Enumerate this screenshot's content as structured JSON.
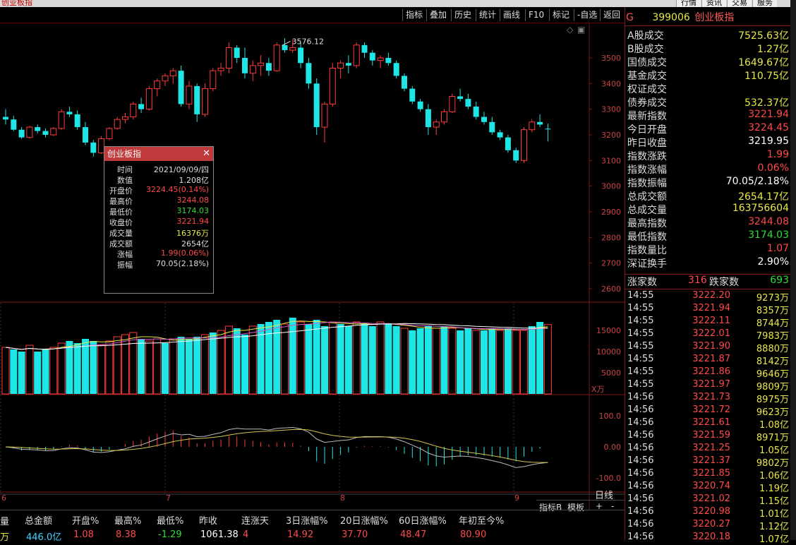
{
  "window": {
    "title": "创业板指",
    "buttons": [
      "行情",
      "资讯",
      "交易",
      "服务"
    ]
  },
  "toolbar": {
    "items": [
      "指标",
      "叠加",
      "历史",
      "统计",
      "画线",
      "F10",
      "标记",
      "-自选",
      "返回"
    ]
  },
  "symbol": {
    "code": "399006",
    "name": "创业板指",
    "prefix": "G"
  },
  "quotes": [
    {
      "label": "A股成交",
      "value": "7525.63亿",
      "color": "#e8e84a"
    },
    {
      "label": "B股成交",
      "value": "1.27亿",
      "color": "#e8e84a"
    },
    {
      "label": "国债成交",
      "value": "1649.67亿",
      "color": "#e8e84a"
    },
    {
      "label": "基金成交",
      "value": "110.75亿",
      "color": "#e8e84a"
    },
    {
      "label": "权证成交",
      "value": "",
      "color": "#e8e84a"
    },
    {
      "label": "债券成交",
      "value": "532.37亿",
      "color": "#e8e84a"
    },
    {
      "label": "最新指数",
      "value": "3221.94",
      "color": "#ff4a4a"
    },
    {
      "label": "今日开盘",
      "value": "3224.45",
      "color": "#ff4a4a"
    },
    {
      "label": "昨日收盘",
      "value": "3219.95",
      "color": "#ffffff"
    },
    {
      "label": "指数涨跌",
      "value": "1.99",
      "color": "#ff4a4a"
    },
    {
      "label": "指数涨幅",
      "value": "0.06%",
      "color": "#ff4a4a"
    },
    {
      "label": "指数振幅",
      "value": "70.05/2.18%",
      "color": "#ffffff"
    },
    {
      "label": "总成交额",
      "value": "2654.17亿",
      "color": "#e8e84a"
    },
    {
      "label": "总成交量",
      "value": "163756604",
      "color": "#e8e84a"
    },
    {
      "label": "最高指数",
      "value": "3244.08",
      "color": "#ff4a4a"
    },
    {
      "label": "最低指数",
      "value": "3174.03",
      "color": "#33dd33"
    },
    {
      "label": "指数量比",
      "value": "1.07",
      "color": "#ff4a4a"
    },
    {
      "label": "深证换手",
      "value": "2.90%",
      "color": "#ffffff"
    }
  ],
  "breadth": {
    "up_label": "涨家数",
    "up": "316",
    "down_label": "跌家数",
    "down": "693"
  },
  "ticks": [
    {
      "t": "14:55",
      "p": "3222.20",
      "q": "9273万"
    },
    {
      "t": "14:55",
      "p": "3221.94",
      "q": "8357万"
    },
    {
      "t": "14:55",
      "p": "3222.11",
      "q": "8744万"
    },
    {
      "t": "14:55",
      "p": "3222.01",
      "q": "7983万"
    },
    {
      "t": "14:55",
      "p": "3221.90",
      "q": "8880万"
    },
    {
      "t": "14:55",
      "p": "3221.87",
      "q": "8142万"
    },
    {
      "t": "14:55",
      "p": "3221.86",
      "q": "9646万"
    },
    {
      "t": "14:55",
      "p": "3221.97",
      "q": "9809万"
    },
    {
      "t": "14:56",
      "p": "3221.73",
      "q": "8975万"
    },
    {
      "t": "14:56",
      "p": "3221.72",
      "q": "9623万"
    },
    {
      "t": "14:56",
      "p": "3221.61",
      "q": "1.08亿"
    },
    {
      "t": "14:56",
      "p": "3221.59",
      "q": "8971万"
    },
    {
      "t": "14:56",
      "p": "3221.25",
      "q": "1.05亿"
    },
    {
      "t": "14:56",
      "p": "3221.37",
      "q": "9802万"
    },
    {
      "t": "14:56",
      "p": "3221.85",
      "q": "1.06亿"
    },
    {
      "t": "14:56",
      "p": "3220.74",
      "q": "1.19亿"
    },
    {
      "t": "14:56",
      "p": "3221.02",
      "q": "1.15亿"
    },
    {
      "t": "14:56",
      "p": "3220.98",
      "q": "1.01亿"
    },
    {
      "t": "14:56",
      "p": "3220.27",
      "q": "1.12亿"
    },
    {
      "t": "14:56",
      "p": "3220.18",
      "q": "1.07亿"
    }
  ],
  "popup": {
    "title": "创业板指",
    "rows": [
      {
        "label": "时间",
        "value": "2021/09/09/四",
        "color": "#dddddd"
      },
      {
        "label": "数值",
        "value": "1.208亿",
        "color": "#dddddd"
      },
      {
        "label": "开盘价",
        "value": "3224.45(0.14%)",
        "color": "#ff4a4a"
      },
      {
        "label": "最高价",
        "value": "3244.08",
        "color": "#ff4a4a"
      },
      {
        "label": "最低价",
        "value": "3174.03",
        "color": "#33dd33"
      },
      {
        "label": "收盘价",
        "value": "3221.94",
        "color": "#ff4a4a"
      },
      {
        "label": "成交量",
        "value": "16376万",
        "color": "#e8e84a"
      },
      {
        "label": "成交额",
        "value": "2654亿",
        "color": "#dddddd"
      },
      {
        "label": "涨幅",
        "value": "1.99(0.06%)",
        "color": "#ff4a4a"
      },
      {
        "label": "振幅",
        "value": "70.05(2.18%)",
        "color": "#dddddd"
      }
    ]
  },
  "chart": {
    "price_ticks": [
      "3500",
      "3400",
      "3300",
      "3200",
      "3100",
      "3000",
      "2900",
      "2800",
      "2700",
      "2600"
    ],
    "price_tick_values": [
      3500,
      3400,
      3300,
      3200,
      3100,
      3000,
      2900,
      2800,
      2700,
      2600
    ],
    "price_range": [
      2600,
      3500
    ],
    "high_label": "3576.12",
    "vol_ticks": [
      "15000",
      "10000",
      "5000"
    ],
    "vol_unit": "X万",
    "vol_range": [
      0,
      15000
    ],
    "macd_ticks": [
      "100.0",
      "0.00",
      "-100.0"
    ],
    "macd_range": [
      -100,
      100
    ],
    "date_labels": [
      "6",
      "7",
      "8",
      "9"
    ],
    "period": "日线",
    "bottom_tabs": [
      "指标B",
      "模板",
      "+",
      "-"
    ],
    "candles": [
      [
        3270,
        3300,
        3240,
        3260
      ],
      [
        3260,
        3275,
        3215,
        3220
      ],
      [
        3220,
        3230,
        3185,
        3190
      ],
      [
        3190,
        3235,
        3185,
        3230
      ],
      [
        3230,
        3240,
        3205,
        3215
      ],
      [
        3215,
        3225,
        3190,
        3200
      ],
      [
        3200,
        3230,
        3195,
        3225
      ],
      [
        3225,
        3300,
        3220,
        3290
      ],
      [
        3290,
        3310,
        3270,
        3280
      ],
      [
        3280,
        3295,
        3220,
        3230
      ],
      [
        3230,
        3250,
        3160,
        3170
      ],
      [
        3170,
        3180,
        3115,
        3130
      ],
      [
        3130,
        3195,
        3125,
        3185
      ],
      [
        3185,
        3230,
        3180,
        3225
      ],
      [
        3225,
        3270,
        3220,
        3260
      ],
      [
        3260,
        3285,
        3245,
        3270
      ],
      [
        3270,
        3330,
        3260,
        3320
      ],
      [
        3320,
        3345,
        3285,
        3300
      ],
      [
        3300,
        3390,
        3295,
        3380
      ],
      [
        3380,
        3420,
        3350,
        3410
      ],
      [
        3410,
        3440,
        3390,
        3430
      ],
      [
        3430,
        3460,
        3400,
        3450
      ],
      [
        3450,
        3470,
        3310,
        3320
      ],
      [
        3320,
        3410,
        3300,
        3390
      ],
      [
        3390,
        3400,
        3250,
        3280
      ],
      [
        3280,
        3400,
        3270,
        3380
      ],
      [
        3380,
        3460,
        3370,
        3450
      ],
      [
        3450,
        3480,
        3430,
        3460
      ],
      [
        3460,
        3560,
        3440,
        3540
      ],
      [
        3540,
        3550,
        3480,
        3500
      ],
      [
        3500,
        3540,
        3420,
        3440
      ],
      [
        3440,
        3490,
        3410,
        3470
      ],
      [
        3470,
        3510,
        3430,
        3480
      ],
      [
        3480,
        3500,
        3430,
        3450
      ],
      [
        3450,
        3560,
        3445,
        3550
      ],
      [
        3550,
        3576,
        3520,
        3530
      ],
      [
        3530,
        3570,
        3520,
        3540
      ],
      [
        3540,
        3560,
        3460,
        3480
      ],
      [
        3480,
        3500,
        3380,
        3400
      ],
      [
        3400,
        3420,
        3200,
        3230
      ],
      [
        3230,
        3330,
        3170,
        3320
      ],
      [
        3320,
        3480,
        3310,
        3460
      ],
      [
        3460,
        3490,
        3420,
        3480
      ],
      [
        3480,
        3510,
        3440,
        3470
      ],
      [
        3470,
        3560,
        3460,
        3550
      ],
      [
        3550,
        3560,
        3500,
        3520
      ],
      [
        3520,
        3530,
        3470,
        3490
      ],
      [
        3490,
        3510,
        3460,
        3500
      ],
      [
        3500,
        3520,
        3470,
        3480
      ],
      [
        3480,
        3490,
        3420,
        3430
      ],
      [
        3430,
        3440,
        3370,
        3380
      ],
      [
        3380,
        3390,
        3320,
        3330
      ],
      [
        3330,
        3340,
        3290,
        3300
      ],
      [
        3300,
        3320,
        3200,
        3230
      ],
      [
        3230,
        3260,
        3200,
        3250
      ],
      [
        3250,
        3300,
        3240,
        3290
      ],
      [
        3290,
        3360,
        3285,
        3350
      ],
      [
        3350,
        3380,
        3330,
        3340
      ],
      [
        3340,
        3360,
        3300,
        3310
      ],
      [
        3310,
        3330,
        3260,
        3270
      ],
      [
        3270,
        3290,
        3240,
        3250
      ],
      [
        3250,
        3270,
        3200,
        3210
      ],
      [
        3210,
        3220,
        3180,
        3190
      ],
      [
        3190,
        3200,
        3130,
        3140
      ],
      [
        3140,
        3150,
        3090,
        3100
      ],
      [
        3100,
        3230,
        3090,
        3220
      ],
      [
        3220,
        3260,
        3210,
        3250
      ],
      [
        3250,
        3280,
        3230,
        3240
      ],
      [
        3224,
        3244,
        3174,
        3222
      ]
    ],
    "volumes": [
      {
        "v": 11000,
        "up": true
      },
      {
        "v": 10500,
        "up": false
      },
      {
        "v": 10000,
        "up": false
      },
      {
        "v": 11500,
        "up": true
      },
      {
        "v": 10000,
        "up": false
      },
      {
        "v": 10500,
        "up": false
      },
      {
        "v": 11000,
        "up": true
      },
      {
        "v": 12000,
        "up": true
      },
      {
        "v": 12500,
        "up": false
      },
      {
        "v": 12000,
        "up": false
      },
      {
        "v": 13000,
        "up": false
      },
      {
        "v": 12500,
        "up": false
      },
      {
        "v": 11500,
        "up": true
      },
      {
        "v": 12500,
        "up": true
      },
      {
        "v": 13500,
        "up": true
      },
      {
        "v": 14000,
        "up": true
      },
      {
        "v": 14500,
        "up": true
      },
      {
        "v": 13000,
        "up": false
      },
      {
        "v": 12500,
        "up": true
      },
      {
        "v": 13000,
        "up": true
      },
      {
        "v": 12000,
        "up": false
      },
      {
        "v": 13000,
        "up": true
      },
      {
        "v": 13500,
        "up": false
      },
      {
        "v": 13000,
        "up": false
      },
      {
        "v": 13500,
        "up": false
      },
      {
        "v": 14000,
        "up": true
      },
      {
        "v": 14500,
        "up": false
      },
      {
        "v": 15000,
        "up": true
      },
      {
        "v": 16000,
        "up": true
      },
      {
        "v": 15500,
        "up": false
      },
      {
        "v": 14000,
        "up": false
      },
      {
        "v": 16000,
        "up": true
      },
      {
        "v": 16500,
        "up": false
      },
      {
        "v": 17000,
        "up": false
      },
      {
        "v": 17500,
        "up": false
      },
      {
        "v": 16500,
        "up": true
      },
      {
        "v": 18000,
        "up": false
      },
      {
        "v": 17000,
        "up": true
      },
      {
        "v": 16500,
        "up": false
      },
      {
        "v": 17500,
        "up": false
      },
      {
        "v": 16000,
        "up": false
      },
      {
        "v": 17000,
        "up": true
      },
      {
        "v": 16500,
        "up": false
      },
      {
        "v": 16000,
        "up": false
      },
      {
        "v": 17000,
        "up": true
      },
      {
        "v": 16500,
        "up": false
      },
      {
        "v": 16000,
        "up": false
      },
      {
        "v": 17000,
        "up": true
      },
      {
        "v": 16500,
        "up": false
      },
      {
        "v": 16000,
        "up": false
      },
      {
        "v": 15500,
        "up": true
      },
      {
        "v": 15000,
        "up": false
      },
      {
        "v": 15500,
        "up": false
      },
      {
        "v": 16000,
        "up": false
      },
      {
        "v": 15500,
        "up": true
      },
      {
        "v": 16000,
        "up": false
      },
      {
        "v": 15500,
        "up": true
      },
      {
        "v": 15000,
        "up": false
      },
      {
        "v": 15500,
        "up": false
      },
      {
        "v": 15000,
        "up": true
      },
      {
        "v": 15000,
        "up": false
      },
      {
        "v": 15500,
        "up": false
      },
      {
        "v": 15000,
        "up": true
      },
      {
        "v": 15500,
        "up": false
      },
      {
        "v": 15000,
        "up": true
      },
      {
        "v": 15000,
        "up": true
      },
      {
        "v": 16000,
        "up": false
      },
      {
        "v": 17000,
        "up": false
      },
      {
        "v": 16376,
        "up": true
      }
    ]
  }
}
